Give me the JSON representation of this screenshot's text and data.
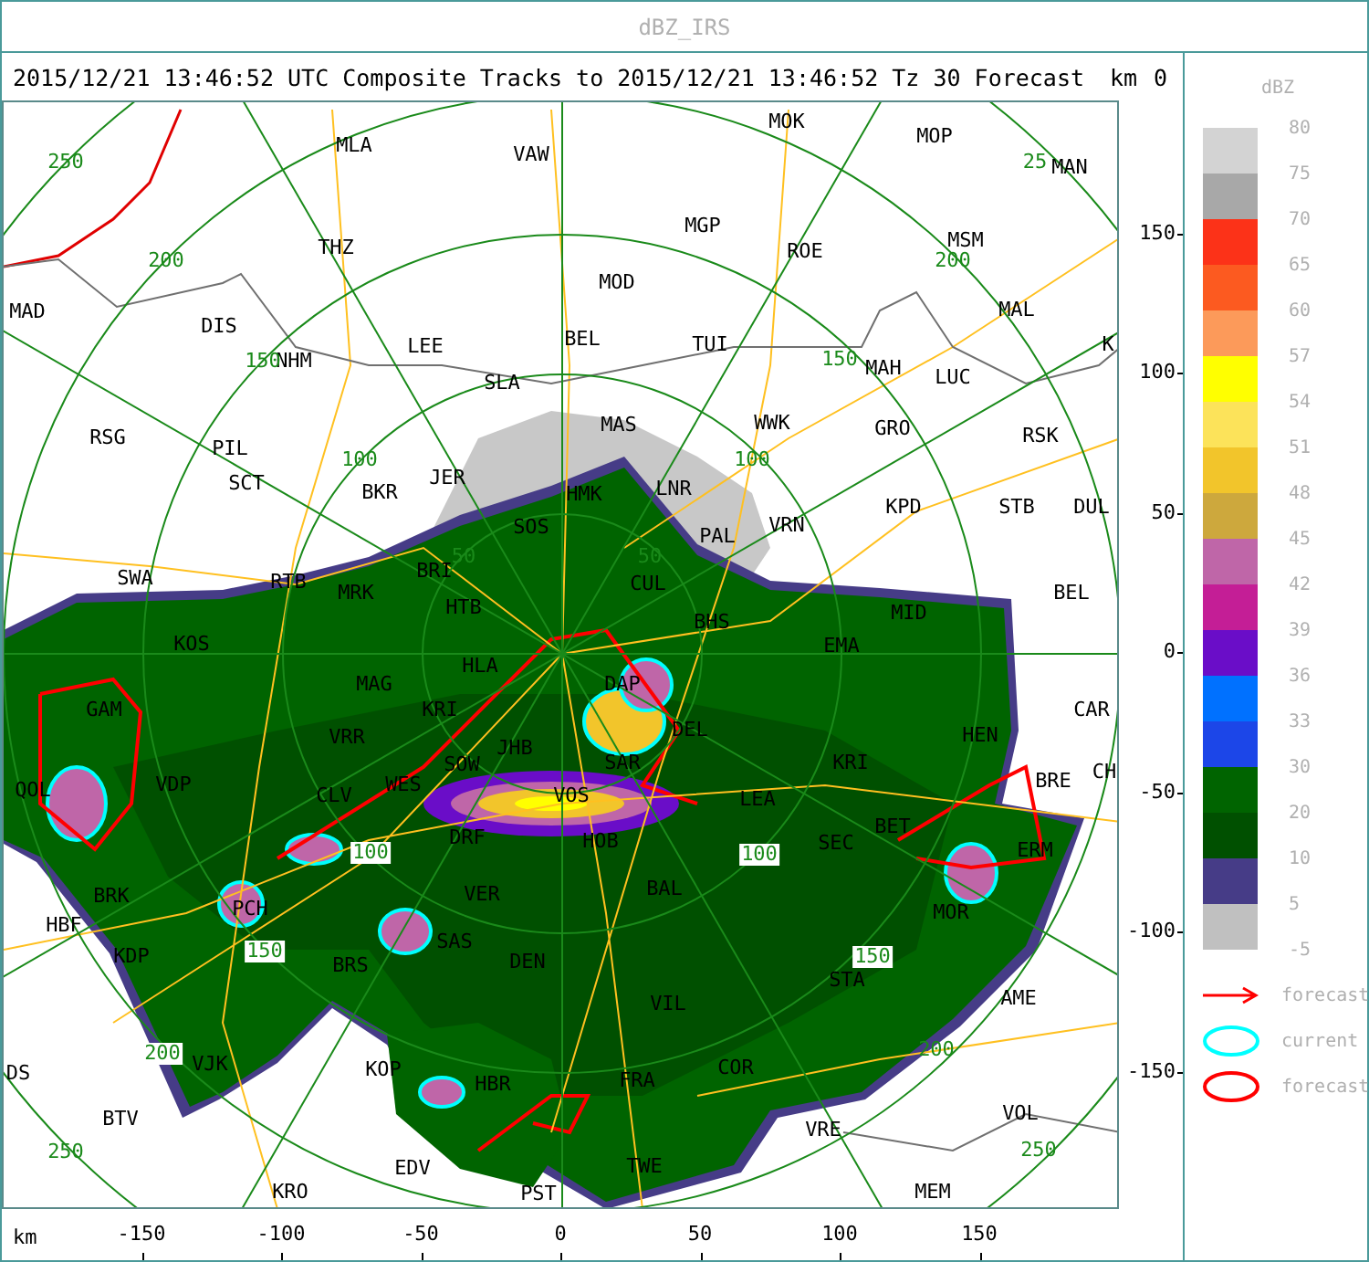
{
  "window": {
    "title": "dBZ_IRS"
  },
  "header": {
    "text": "2015/12/21 13:46:52 UTC Composite Tracks to 2015/12/21 13:46:52 Tz 30 Forecast",
    "axis_unit": "km",
    "axis_zero": "0"
  },
  "map": {
    "places": [
      "MOK",
      "MLA",
      "MOP",
      "VAW",
      "MAN",
      "MGP",
      "THZ",
      "ROE",
      "MSM",
      "MOD",
      "MAD",
      "MAL",
      "DIS",
      "LEE",
      "BEL",
      "TUI",
      "K",
      "NHM",
      "SLA",
      "MAH",
      "LUC",
      "RSG",
      "MAS",
      "WWK",
      "GRO",
      "RSK",
      "PIL",
      "SCT",
      "BKR",
      "JER",
      "HMK",
      "LNR",
      "KPD",
      "STB",
      "DUL",
      "SOS",
      "PAL",
      "VRN",
      "SWA",
      "RTB",
      "MRK",
      "BRI",
      "CUL",
      "BEL",
      "HTB",
      "MID",
      "BHS",
      "KOS",
      "EMA",
      "HLA",
      "MAG",
      "DAP",
      "GAM",
      "KRI",
      "CAR",
      "VRR",
      "JHB",
      "DEL",
      "HEN",
      "SOW",
      "SAR",
      "KRI",
      "QOL",
      "VDP",
      "CLV",
      "WES",
      "VOS",
      "LEA",
      "BRE",
      "CH",
      "BET",
      "DRF",
      "HOB",
      "SEC",
      "ERM",
      "BRK",
      "VER",
      "BAL",
      "PCH",
      "MOR",
      "HBF",
      "SAS",
      "KDP",
      "BRS",
      "DEN",
      "STA",
      "VIL",
      "AME",
      "DS",
      "VJK",
      "KOP",
      "COR",
      "HBR",
      "FRA",
      "BTV",
      "VOL",
      "VRE",
      "EDV",
      "TWE",
      "KRO",
      "PST",
      "MEM"
    ],
    "range_labels": [
      {
        "text": "250",
        "kind": "plain"
      },
      {
        "text": "200",
        "kind": "plain"
      },
      {
        "text": "150",
        "kind": "plain"
      },
      {
        "text": "100",
        "kind": "plain"
      },
      {
        "text": "50",
        "kind": "plain"
      },
      {
        "text": "50",
        "kind": "plain"
      },
      {
        "text": "100",
        "kind": "plain"
      },
      {
        "text": "150",
        "kind": "plain"
      },
      {
        "text": "200",
        "kind": "plain"
      },
      {
        "text": "25",
        "kind": "plain"
      },
      {
        "text": "100",
        "kind": "boxed"
      },
      {
        "text": "150",
        "kind": "boxed"
      },
      {
        "text": "200",
        "kind": "boxed"
      },
      {
        "text": "250",
        "kind": "plain"
      },
      {
        "text": "100",
        "kind": "boxed"
      },
      {
        "text": "150",
        "kind": "boxed"
      },
      {
        "text": "200",
        "kind": "plain"
      },
      {
        "text": "250",
        "kind": "plain"
      }
    ]
  },
  "y_axis": {
    "ticks": [
      "150",
      "100",
      "50",
      "0",
      "-50",
      "-100",
      "-150"
    ]
  },
  "x_axis": {
    "unit": "km",
    "ticks": [
      "-150",
      "-100",
      "-50",
      "0",
      "50",
      "100",
      "150"
    ]
  },
  "legend": {
    "title": "dBZ",
    "labels": [
      "80",
      "75",
      "70",
      "65",
      "60",
      "57",
      "54",
      "51",
      "48",
      "45",
      "42",
      "39",
      "36",
      "33",
      "30",
      "20",
      "10",
      "5",
      "-5"
    ],
    "bins": [
      {
        "color": "#d3d3d3"
      },
      {
        "color": "#a8a8a8"
      },
      {
        "color": "#fc3218"
      },
      {
        "color": "#fc5a20"
      },
      {
        "color": "#fc9a5a"
      },
      {
        "color": "#ffff00"
      },
      {
        "color": "#fce35a"
      },
      {
        "color": "#f2c52b"
      },
      {
        "color": "#cda83d"
      },
      {
        "color": "#bf66a8"
      },
      {
        "color": "#c41e96"
      },
      {
        "color": "#6a0dc8"
      },
      {
        "color": "#0071ff"
      },
      {
        "color": "#1c46e8"
      },
      {
        "color": "#006400"
      },
      {
        "color": "#005000"
      },
      {
        "color": "#463c87"
      },
      {
        "color": "#c0c0c0"
      }
    ],
    "keys": [
      {
        "kind": "track-arrow",
        "label": "forecast"
      },
      {
        "kind": "current-outline",
        "label": "current"
      },
      {
        "kind": "forecast-outline",
        "label": "forecast"
      }
    ]
  }
}
